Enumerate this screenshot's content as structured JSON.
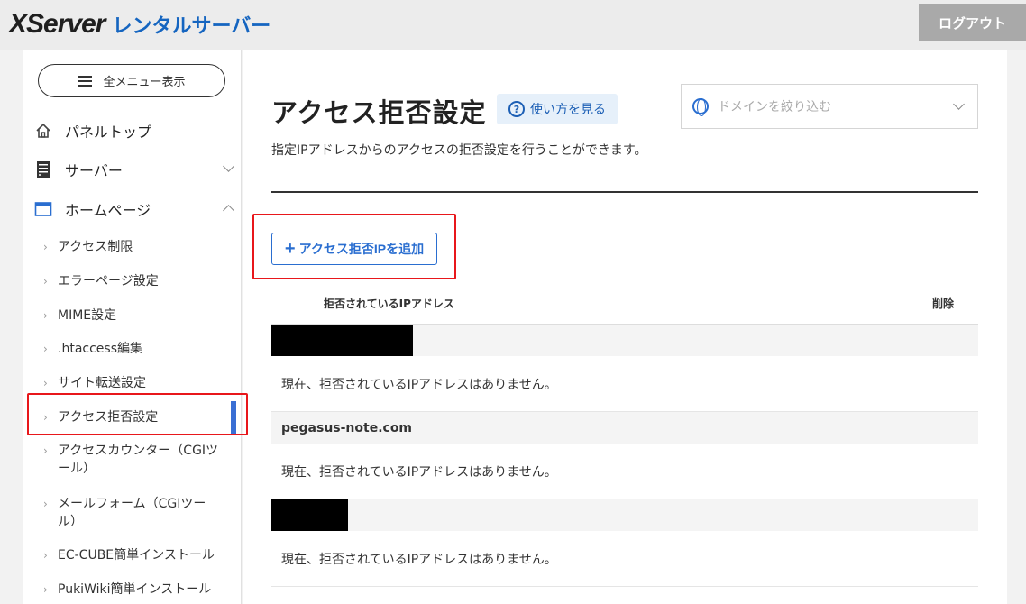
{
  "header": {
    "logo_main": "XServer",
    "logo_sub": "レンタルサーバー",
    "logout_label": "ログアウト"
  },
  "sidebar": {
    "menu_button": "全メニュー表示",
    "main_items": [
      {
        "label": "パネルトップ",
        "icon": "home-icon"
      },
      {
        "label": "サーバー",
        "icon": "server-icon"
      },
      {
        "label": "ホームページ",
        "icon": "window-icon"
      }
    ],
    "sub_items": [
      {
        "label": "アクセス制限"
      },
      {
        "label": "エラーページ設定"
      },
      {
        "label": "MIME設定"
      },
      {
        "label": ".htaccess編集"
      },
      {
        "label": "サイト転送設定"
      },
      {
        "label": "アクセス拒否設定"
      },
      {
        "label": "アクセスカウンター（CGIツール）"
      },
      {
        "label": "メールフォーム（CGIツール）"
      },
      {
        "label": "EC-CUBE簡単インストール"
      },
      {
        "label": "PukiWiki簡単インストール"
      }
    ],
    "active_item": "アクセス拒否設定"
  },
  "main": {
    "title": "アクセス拒否設定",
    "help_label": "使い方を見る",
    "help_icon_glyph": "?",
    "domain_placeholder": "ドメインを絞り込む",
    "description": "指定IPアドレスからのアクセスの拒否設定を行うことができます。",
    "add_button": "アクセス拒否IPを追加",
    "table": {
      "col_ip": "拒否されているIPアドレス",
      "col_delete": "削除"
    },
    "domains": [
      {
        "name": "",
        "redacted": true,
        "message": "現在、拒否されているIPアドレスはありません。"
      },
      {
        "name": "pegasus-note.com",
        "redacted": false,
        "message": "現在、拒否されているIPアドレスはありません。"
      },
      {
        "name": "",
        "redacted": true,
        "message": "現在、拒否されているIPアドレスはありません。"
      }
    ]
  },
  "colors": {
    "accent": "#2a6ed0",
    "highlight": "#e8171b",
    "logout_bg": "#a9a9a9"
  }
}
